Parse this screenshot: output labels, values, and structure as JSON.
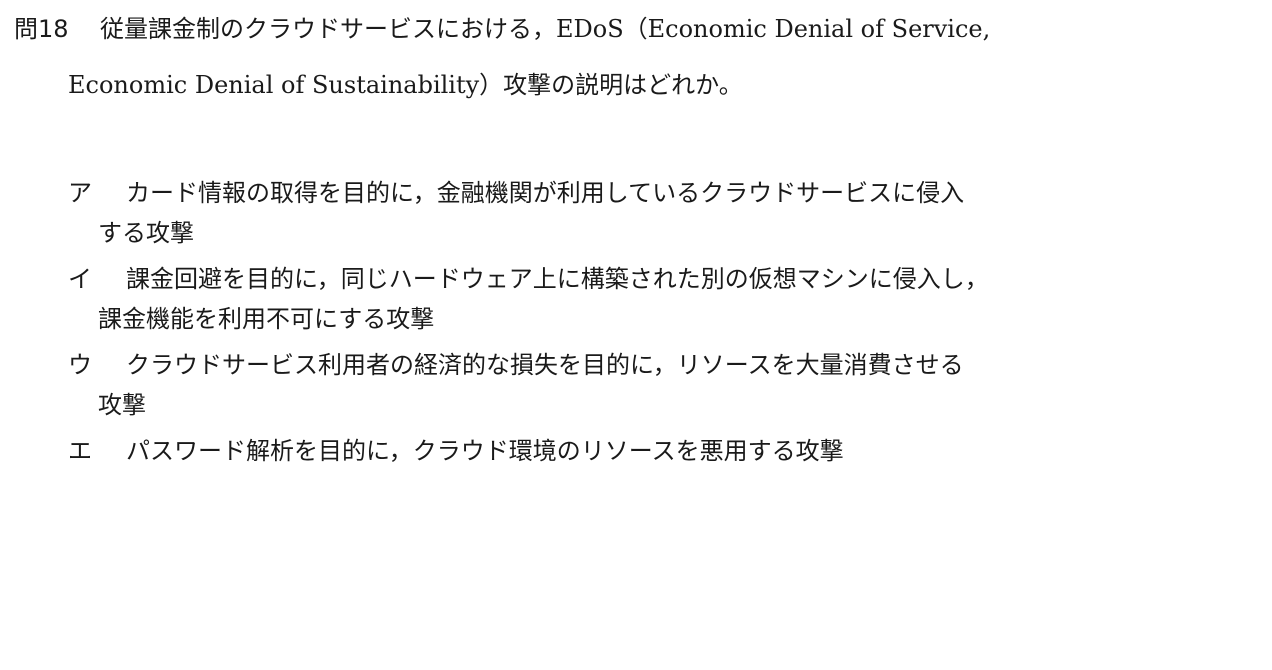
{
  "question": {
    "number": "問18",
    "line1": "従量課金制のクラウドサービスにおける，EDoS（Economic Denial of Service,",
    "line2": "Economic Denial of Sustainability）攻撃の説明はどれか。"
  },
  "choices": [
    {
      "label": "ア",
      "text": "カード情報の取得を目的に，金融機関が利用しているクラウドサービスに侵入",
      "cont": "する攻撃"
    },
    {
      "label": "イ",
      "text": "課金回避を目的に，同じハードウェア上に構築された別の仮想マシンに侵入し，",
      "cont": "課金機能を利用不可にする攻撃"
    },
    {
      "label": "ウ",
      "text": "クラウドサービス利用者の経済的な損失を目的に，リソースを大量消費させる",
      "cont": "攻撃"
    },
    {
      "label": "エ",
      "text": "パスワード解析を目的に，クラウド環境のリソースを悪用する攻撃",
      "cont": ""
    }
  ]
}
